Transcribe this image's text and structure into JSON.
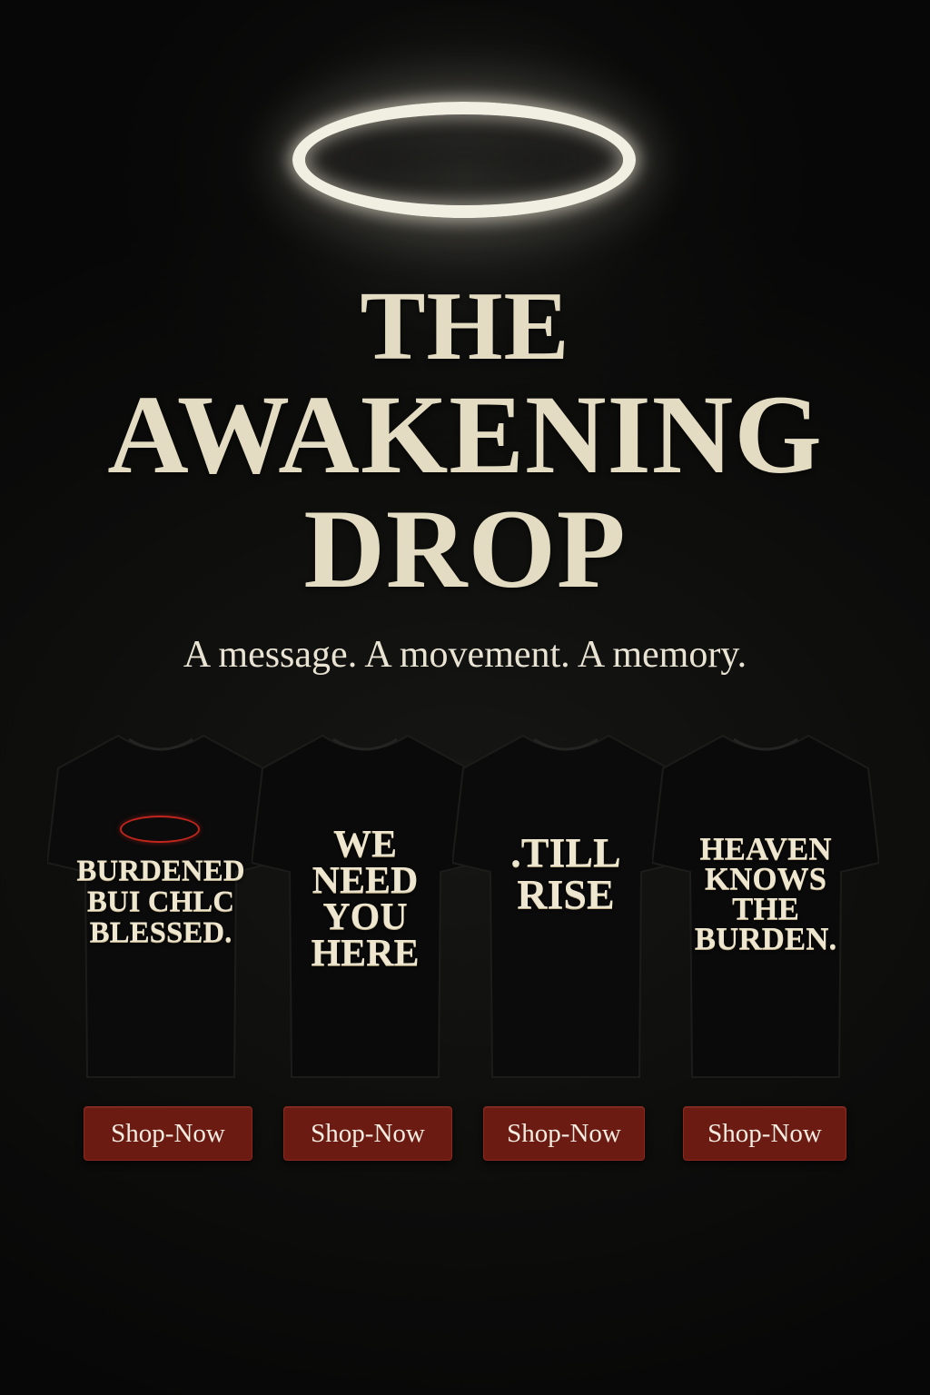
{
  "hero": {
    "title_line_1": "THE",
    "title_line_2": "AWAKENING",
    "title_line_3": "DROP",
    "tagline": "A message. A movement. A memory.",
    "halo_color": "#f1eee2",
    "title_color": "#e3dcc2"
  },
  "products": [
    {
      "print_lines": [
        "BURDENED",
        "BUI CHLC",
        "BLESSED."
      ],
      "button_label": "Shop-Now"
    },
    {
      "print_lines": [
        "WE",
        "NEED",
        "YOU",
        "HERE"
      ],
      "button_label": "Shop-Now"
    },
    {
      "print_lines": [
        ".TILL",
        "RISE"
      ],
      "button_label": "Shop-Now"
    },
    {
      "print_lines": [
        "HEAVEN",
        "KNOWS",
        "THE",
        "BURDEN."
      ],
      "button_label": "Shop-Now"
    }
  ],
  "colors": {
    "background": "#0c0c0b",
    "button": "#6b1b12",
    "button_text": "#f4ece0",
    "shirt": "#0b0b0b",
    "print": "#eee6cf",
    "accent_halo": "#c2251c"
  }
}
